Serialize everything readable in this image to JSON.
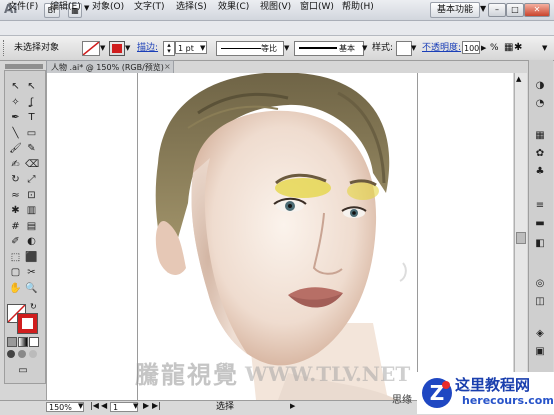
{
  "window": {
    "app_logo": "Ai",
    "workspace": "基本功能",
    "controls": [
      "–",
      "□",
      "✕"
    ]
  },
  "menubar": [
    "文件(F)",
    "编辑(E)",
    "对象(O)",
    "文字(T)",
    "选择(S)",
    "效果(C)",
    "视图(V)",
    "窗口(W)",
    "帮助(H)"
  ],
  "controlbar": {
    "selection_status": "未选择对象",
    "stroke_label": "描边:",
    "stroke_weight": "1 pt",
    "profile_label": "等比",
    "brush_label": "基本",
    "style_label": "样式:",
    "opacity_label": "不透明度:",
    "opacity_value": "100",
    "opacity_unit": "%",
    "fill_color": "#ffffff",
    "stroke_color": "#d01e1e"
  },
  "document": {
    "tab_title": "人物 .ai* @ 150% (RGB/预览)",
    "tab_close": "×"
  },
  "statusbar": {
    "zoom": "150%",
    "page": "1",
    "tool_status": "选择"
  },
  "watermarks": {
    "tlv_chinese": "騰龍視覺",
    "tlv_url": "WWW.TLV.NET",
    "small_text": "思缘",
    "logo_text": "这里教程网",
    "logo_url": "herecours.com"
  },
  "tools": {
    "icons": [
      "selection-icon",
      "direct-selection-icon",
      "magic-wand-icon",
      "lasso-icon",
      "pen-icon",
      "type-icon",
      "line-icon",
      "rectangle-icon",
      "paintbrush-icon",
      "pencil-icon",
      "blob-brush-icon",
      "eraser-icon",
      "rotate-icon",
      "scale-icon",
      "warp-icon",
      "free-transform-icon",
      "symbol-sprayer-icon",
      "column-graph-icon",
      "mesh-icon",
      "gradient-icon",
      "eyedropper-icon",
      "blend-icon",
      "live-paint-icon",
      "live-paint-selection-icon",
      "artboard-icon",
      "slice-icon",
      "hand-icon",
      "zoom-icon"
    ],
    "glyphs": [
      "↖",
      "↖",
      "✧",
      "ʆ",
      "✒",
      "T",
      "╲",
      "▭",
      "🖌",
      "✎",
      "✍",
      "⌫",
      "↻",
      "⤢",
      "≈",
      "⊡",
      "✱",
      "▥",
      "#",
      "▤",
      "✐",
      "◐",
      "⬚",
      "⬛",
      "▢",
      "✂",
      "✋",
      "🔍"
    ],
    "screen_mode_glyph": "▭"
  },
  "rightpanel": {
    "icons": [
      "color-panel-icon",
      "color-guide-icon",
      "swatches-icon",
      "brushes-icon",
      "symbols-icon",
      "stroke-icon",
      "gradient-panel-icon",
      "transparency-icon",
      "appearance-icon",
      "graphic-styles-icon",
      "layers-icon",
      "artboards-icon"
    ],
    "glyphs": [
      "◑",
      "◔",
      "▦",
      "✿",
      "♣",
      "≡",
      "▬",
      "◧",
      "◎",
      "◫",
      "◈",
      "▣"
    ]
  }
}
